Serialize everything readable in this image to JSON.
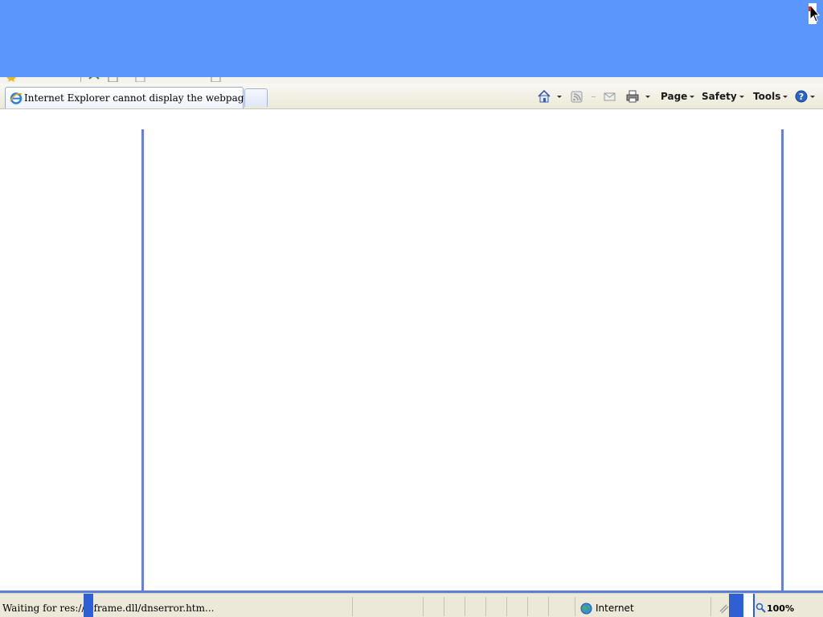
{
  "tab": {
    "title": "Internet Explorer cannot display the webpage"
  },
  "command_bar": {
    "page_label": "Page",
    "safety_label": "Safety",
    "tools_label": "Tools"
  },
  "icons": {
    "tab": "ie-icon",
    "home": "home-icon",
    "feeds": "rss-feed-icon",
    "read_mail": "mail-icon",
    "print": "printer-icon",
    "help": "help-icon",
    "zone": "globe-icon",
    "zoom": "magnifier-icon",
    "cursor": "mouse-cursor-icon"
  },
  "status_bar": {
    "text": "Waiting for res://ieframe.dll/dnserror.htm...",
    "zone": "Internet",
    "zoom": "100%"
  },
  "colors": {
    "top_band": "#5b96fc",
    "frame_border": "#6b7fd6",
    "status_divider": "#5a7fd8",
    "chrome_bg": "#ece9d8"
  }
}
